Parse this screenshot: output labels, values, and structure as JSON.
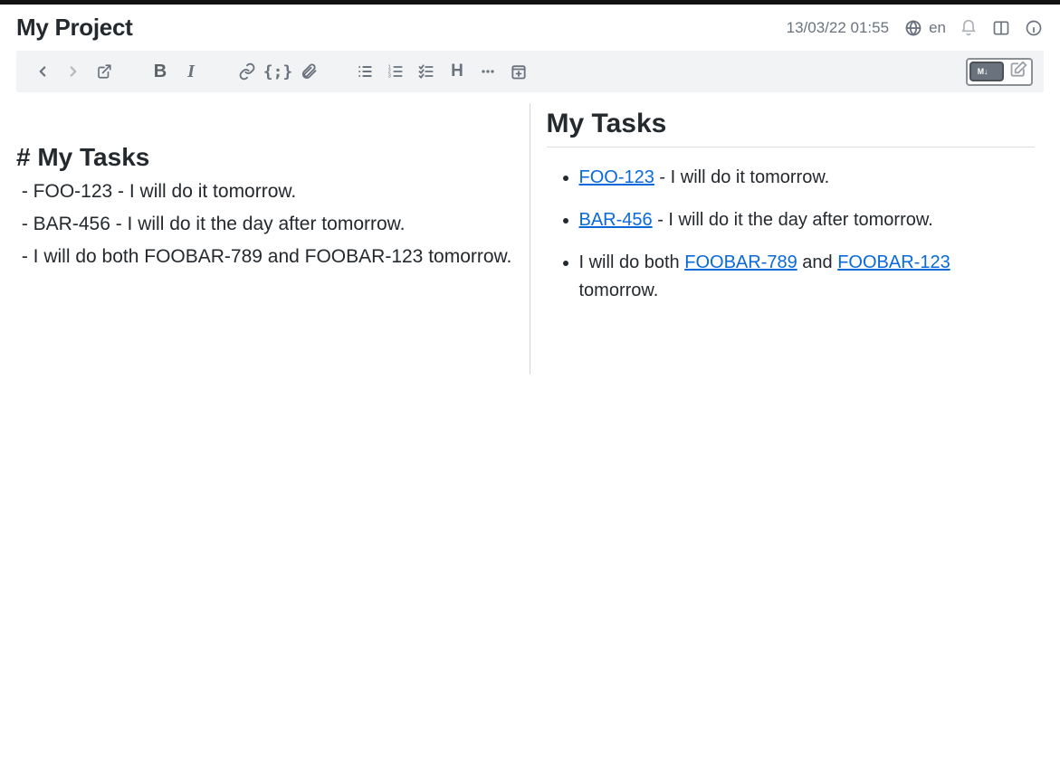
{
  "header": {
    "title": "My Project",
    "timestamp": "13/03/22 01:55",
    "language": "en"
  },
  "toolbar": {
    "back": "back",
    "forward": "forward",
    "open_external": "open-external",
    "bold": "B",
    "italic": "I",
    "link": "link",
    "code": "{;}",
    "attach": "attach",
    "ul": "ul",
    "ol": "ol",
    "checklist": "checklist",
    "heading": "H",
    "more": "more",
    "insert": "insert",
    "markdown_badge": "M↓",
    "compose": "compose"
  },
  "editor": {
    "heading_raw": "# My Tasks",
    "lines": [
      " - FOO-123 - I will do it tomorrow.",
      " - BAR-456 - I will do it the day after tomorrow.",
      " - I will do both FOOBAR-789 and FOOBAR-123 tomorrow."
    ]
  },
  "preview": {
    "heading": "My Tasks",
    "items": [
      {
        "link1": "FOO-123",
        "mid": " - I will do it tomorrow."
      },
      {
        "link1": "BAR-456",
        "mid": " - I will do it the day after tomorrow."
      },
      {
        "pre": "I will do both ",
        "link1": "FOOBAR-789",
        "mid": " and ",
        "link2": "FOOBAR-123",
        "post": " tomorrow."
      }
    ]
  }
}
